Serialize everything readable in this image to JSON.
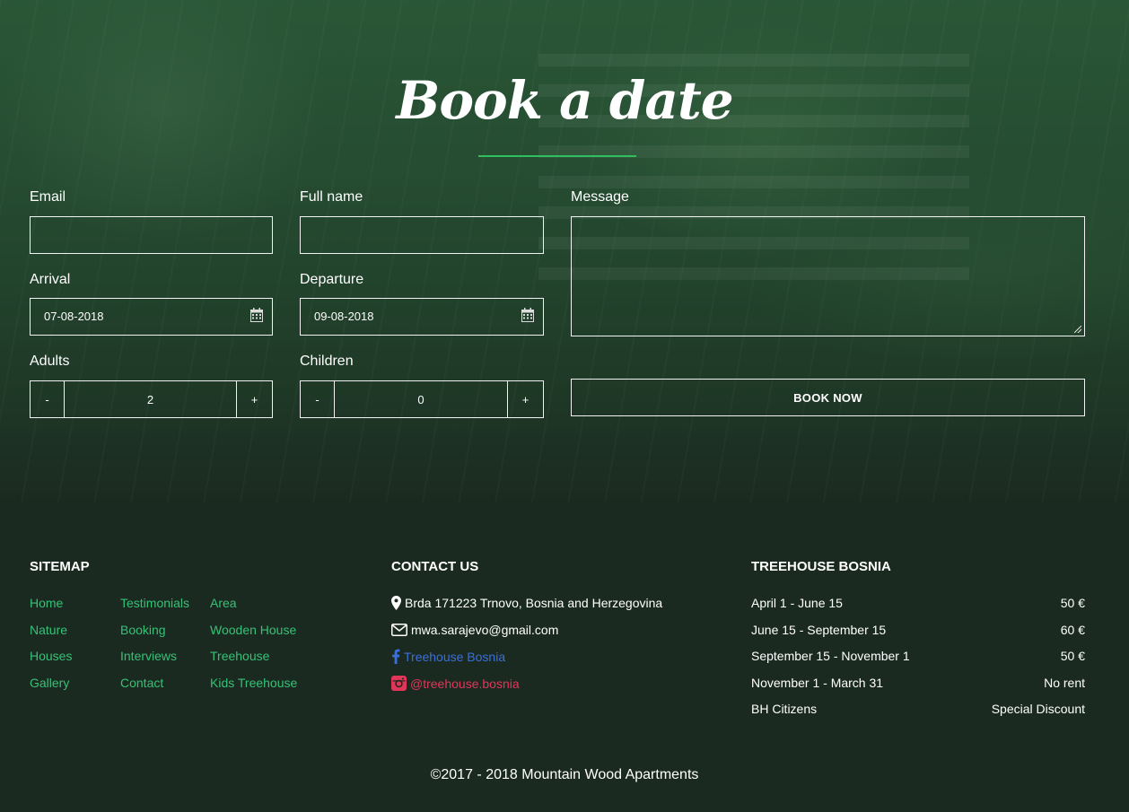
{
  "booking": {
    "title": "Book a date",
    "email_label": "Email",
    "fullname_label": "Full name",
    "message_label": "Message",
    "arrival_label": "Arrival",
    "arrival_value": "07-08-2018",
    "departure_label": "Departure",
    "departure_value": "09-08-2018",
    "adults_label": "Adults",
    "adults_value": "2",
    "children_label": "Children",
    "children_value": "0",
    "minus": "-",
    "plus": "+",
    "submit_label": "BOOK NOW"
  },
  "footer": {
    "sitemap": {
      "heading": "SITEMAP",
      "links": [
        "Home",
        "Testimonials",
        "Area",
        "Nature",
        "Booking",
        "Wooden House",
        "Houses",
        "Interviews",
        "Treehouse",
        "Gallery",
        "Contact",
        "Kids Treehouse"
      ]
    },
    "contact": {
      "heading": "CONTACT US",
      "address": "Brda 171223 Trnovo, Bosnia and Herzegovina",
      "email": "mwa.sarajevo@gmail.com",
      "facebook": "Treehouse Bosnia",
      "instagram": "@treehouse.bosnia"
    },
    "prices": {
      "heading": "TREEHOUSE BOSNIA",
      "rows": [
        {
          "period": "April 1 - June 15",
          "price": "50 €"
        },
        {
          "period": "June 15 - September 15",
          "price": "60 €"
        },
        {
          "period": "September 15 - November 1",
          "price": "50 €"
        },
        {
          "period": "November 1 - March 31",
          "price": "No rent"
        },
        {
          "period": "BH Citizens",
          "price": "Special Discount"
        }
      ]
    },
    "copyright": "©2017 - 2018 Mountain Wood Apartments"
  },
  "colors": {
    "accent": "#2fbf5f",
    "link": "#36c177",
    "facebook": "#3b6fd8",
    "instagram": "#e0365a"
  },
  "icons": [
    "calendar-icon",
    "map-marker-icon",
    "envelope-icon",
    "facebook-icon",
    "instagram-icon"
  ]
}
